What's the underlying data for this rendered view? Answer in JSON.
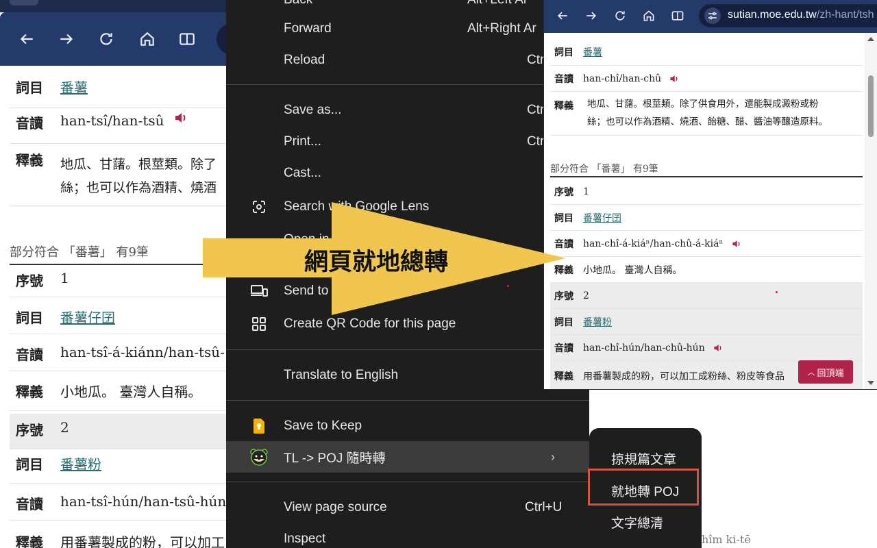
{
  "left_browser": {
    "rows": [
      {
        "key": "詞目",
        "value": "番薯",
        "link": true
      },
      {
        "key": "音讀",
        "value": "han-tsî/han-tsû",
        "audio": true
      },
      {
        "key": "釋義",
        "value": "地瓜、甘藷。根莖類。除了",
        "value2": "絲；也可以作為酒精、燒酒"
      }
    ],
    "section_title": "部分符合 「番薯」 有9筆",
    "partial_rows": [
      {
        "key": "序號",
        "value": "1"
      },
      {
        "key": "詞目",
        "value": "番薯仔囝",
        "link": true
      },
      {
        "key": "音讀",
        "value": "han-tsî-á-kiánn/han-tsû-"
      },
      {
        "key": "釋義",
        "value": "小地瓜。 臺灣人自稱。"
      },
      {
        "key": "序號",
        "value": "2",
        "shaded": true
      },
      {
        "key": "詞目",
        "value": "番薯粉",
        "link": true
      },
      {
        "key": "音讀",
        "value": "han-tsî-hún/han-tsû-hún"
      },
      {
        "key": "釋義",
        "value": "用番薯製成的粉，可以加工"
      }
    ]
  },
  "context_menu": {
    "items": [
      {
        "label": "Back",
        "shortcut": "Alt+Left Ar"
      },
      {
        "label": "Forward",
        "shortcut": "Alt+Right Ar"
      },
      {
        "label": "Reload",
        "shortcut": "Ctr"
      },
      {
        "label": "Save as...",
        "shortcut": "Ctr"
      },
      {
        "label": "Print...",
        "shortcut": "Ctr"
      },
      {
        "label": "Cast..."
      },
      {
        "label": "Search with Google Lens"
      },
      {
        "label": "Open in"
      },
      {
        "label": "Send to"
      },
      {
        "label": "Create QR Code for this page"
      },
      {
        "label": "Translate to English"
      },
      {
        "label": "Save to Keep"
      },
      {
        "label": "TL -> POJ 隨時轉"
      },
      {
        "label": "View page source",
        "shortcut": "Ctrl+U"
      },
      {
        "label": "Inspect"
      }
    ]
  },
  "submenu": {
    "items": [
      "掠規篇文章",
      "就地轉 POJ",
      "文字總清"
    ]
  },
  "overlay": {
    "arrow_text": "網頁就地總轉",
    "arrow_color": "#f0c64e"
  },
  "right_browser": {
    "url_host": "sutian.moe.edu.tw",
    "url_path": "/zh-hant/tsh",
    "rows": [
      {
        "key": "詞目",
        "value": "番薯",
        "link": true
      },
      {
        "key": "音讀",
        "value": "han-chî/han-chû",
        "audio": true
      },
      {
        "key": "釋義",
        "value": "地瓜、甘藷。根莖類。除了供食用外，還能製成澱粉或粉",
        "value2": "絲；也可以作為酒精、燒酒、飴糖、醋、醬油等釀造原料。"
      }
    ],
    "section_title": "部分符合 「番薯」 有9筆",
    "partial_rows": [
      {
        "key": "序號",
        "value": "1"
      },
      {
        "key": "詞目",
        "value": "番薯仔囝",
        "link": true
      },
      {
        "key": "音讀",
        "value": "han-chî-á-kiáⁿ/han-chû-á-kiáⁿ",
        "audio": true
      },
      {
        "key": "釋義",
        "value": "小地瓜。 臺灣人自稱。"
      },
      {
        "key": "序號",
        "value": "2",
        "shaded": true
      },
      {
        "key": "詞目",
        "value": "番薯粉",
        "link": true,
        "shaded": true
      },
      {
        "key": "音讀",
        "value": "han-chî-hún/han-chû-hún",
        "audio": true,
        "shaded": true
      },
      {
        "key": "釋義",
        "value": "用番薯製成的粉，可以加工成粉絲、粉皮等食品",
        "shaded": true
      }
    ],
    "back_to_top": "回頂端"
  },
  "stray_text": "hîm ki-tē",
  "colors": {
    "chrome_bar": "#243a6b",
    "menu_bg": "#1e1e1e",
    "link": "#2b6f73",
    "speaker": "#b1234a",
    "highlight_box": "#d5533e"
  }
}
